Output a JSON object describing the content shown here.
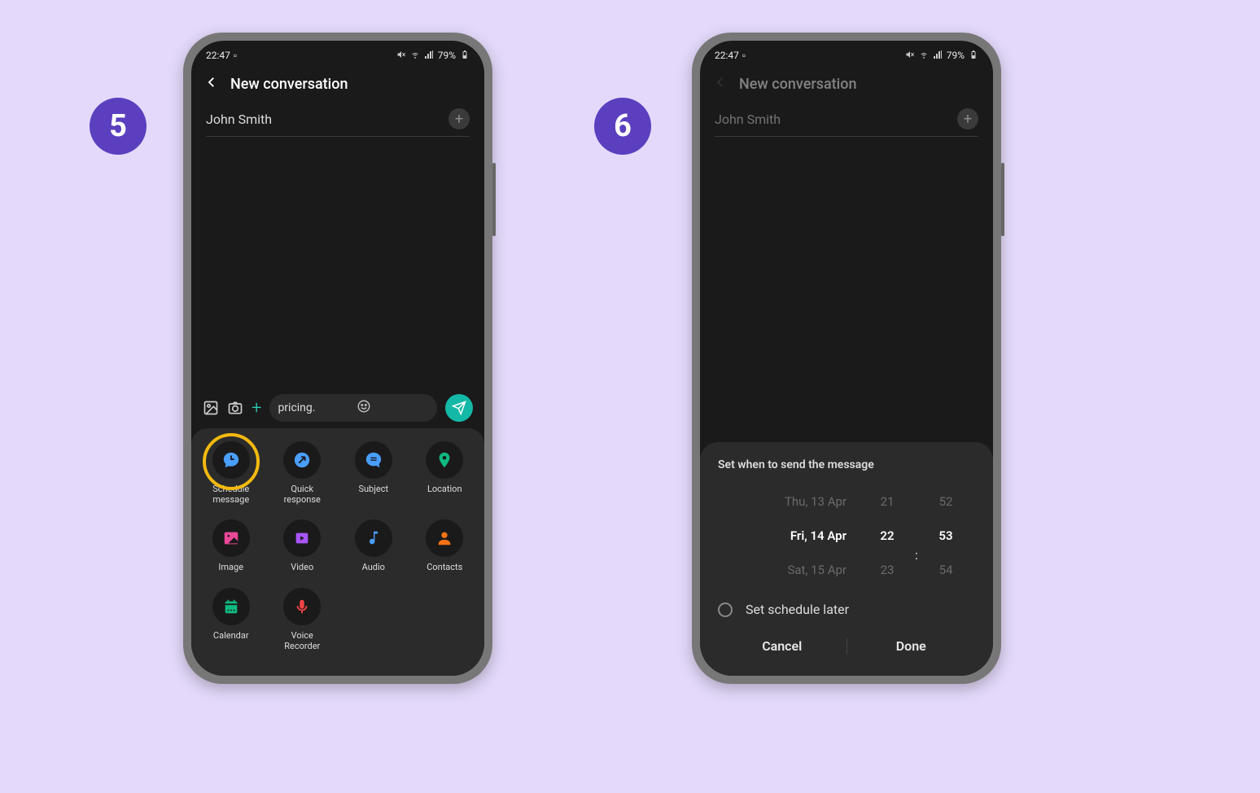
{
  "steps": {
    "five": "5",
    "six": "6"
  },
  "status": {
    "time": "22:47",
    "battery": "79%"
  },
  "header": {
    "title": "New conversation"
  },
  "recipient": "John Smith",
  "compose": {
    "text": "pricing."
  },
  "attach": {
    "schedule": "Schedule\nmessage",
    "quick": "Quick\nresponse",
    "subject": "Subject",
    "location": "Location",
    "image": "Image",
    "video": "Video",
    "audio": "Audio",
    "contacts": "Contacts",
    "calendar": "Calendar",
    "voice": "Voice\nRecorder"
  },
  "picker": {
    "title": "Set when to send the message",
    "date_prev": "Thu, 13 Apr",
    "date_sel": "Fri, 14 Apr",
    "date_next": "Sat, 15 Apr",
    "hour_prev": "21",
    "hour_sel": "22",
    "hour_next": "23",
    "min_prev": "52",
    "min_sel": "53",
    "min_next": "54",
    "colon": ":",
    "later": "Set schedule later",
    "cancel": "Cancel",
    "done": "Done"
  }
}
